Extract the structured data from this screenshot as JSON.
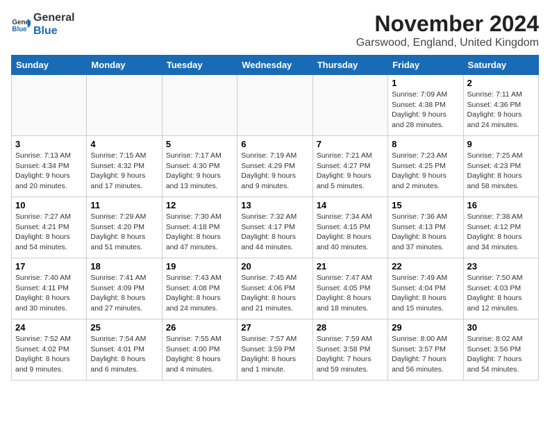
{
  "logo": {
    "general": "General",
    "blue": "Blue"
  },
  "title": "November 2024",
  "location": "Garswood, England, United Kingdom",
  "weekdays": [
    "Sunday",
    "Monday",
    "Tuesday",
    "Wednesday",
    "Thursday",
    "Friday",
    "Saturday"
  ],
  "weeks": [
    [
      {
        "day": "",
        "info": ""
      },
      {
        "day": "",
        "info": ""
      },
      {
        "day": "",
        "info": ""
      },
      {
        "day": "",
        "info": ""
      },
      {
        "day": "",
        "info": ""
      },
      {
        "day": "1",
        "info": "Sunrise: 7:09 AM\nSunset: 4:38 PM\nDaylight: 9 hours\nand 28 minutes."
      },
      {
        "day": "2",
        "info": "Sunrise: 7:11 AM\nSunset: 4:36 PM\nDaylight: 9 hours\nand 24 minutes."
      }
    ],
    [
      {
        "day": "3",
        "info": "Sunrise: 7:13 AM\nSunset: 4:34 PM\nDaylight: 9 hours\nand 20 minutes."
      },
      {
        "day": "4",
        "info": "Sunrise: 7:15 AM\nSunset: 4:32 PM\nDaylight: 9 hours\nand 17 minutes."
      },
      {
        "day": "5",
        "info": "Sunrise: 7:17 AM\nSunset: 4:30 PM\nDaylight: 9 hours\nand 13 minutes."
      },
      {
        "day": "6",
        "info": "Sunrise: 7:19 AM\nSunset: 4:29 PM\nDaylight: 9 hours\nand 9 minutes."
      },
      {
        "day": "7",
        "info": "Sunrise: 7:21 AM\nSunset: 4:27 PM\nDaylight: 9 hours\nand 5 minutes."
      },
      {
        "day": "8",
        "info": "Sunrise: 7:23 AM\nSunset: 4:25 PM\nDaylight: 9 hours\nand 2 minutes."
      },
      {
        "day": "9",
        "info": "Sunrise: 7:25 AM\nSunset: 4:23 PM\nDaylight: 8 hours\nand 58 minutes."
      }
    ],
    [
      {
        "day": "10",
        "info": "Sunrise: 7:27 AM\nSunset: 4:21 PM\nDaylight: 8 hours\nand 54 minutes."
      },
      {
        "day": "11",
        "info": "Sunrise: 7:29 AM\nSunset: 4:20 PM\nDaylight: 8 hours\nand 51 minutes."
      },
      {
        "day": "12",
        "info": "Sunrise: 7:30 AM\nSunset: 4:18 PM\nDaylight: 8 hours\nand 47 minutes."
      },
      {
        "day": "13",
        "info": "Sunrise: 7:32 AM\nSunset: 4:17 PM\nDaylight: 8 hours\nand 44 minutes."
      },
      {
        "day": "14",
        "info": "Sunrise: 7:34 AM\nSunset: 4:15 PM\nDaylight: 8 hours\nand 40 minutes."
      },
      {
        "day": "15",
        "info": "Sunrise: 7:36 AM\nSunset: 4:13 PM\nDaylight: 8 hours\nand 37 minutes."
      },
      {
        "day": "16",
        "info": "Sunrise: 7:38 AM\nSunset: 4:12 PM\nDaylight: 8 hours\nand 34 minutes."
      }
    ],
    [
      {
        "day": "17",
        "info": "Sunrise: 7:40 AM\nSunset: 4:11 PM\nDaylight: 8 hours\nand 30 minutes."
      },
      {
        "day": "18",
        "info": "Sunrise: 7:41 AM\nSunset: 4:09 PM\nDaylight: 8 hours\nand 27 minutes."
      },
      {
        "day": "19",
        "info": "Sunrise: 7:43 AM\nSunset: 4:08 PM\nDaylight: 8 hours\nand 24 minutes."
      },
      {
        "day": "20",
        "info": "Sunrise: 7:45 AM\nSunset: 4:06 PM\nDaylight: 8 hours\nand 21 minutes."
      },
      {
        "day": "21",
        "info": "Sunrise: 7:47 AM\nSunset: 4:05 PM\nDaylight: 8 hours\nand 18 minutes."
      },
      {
        "day": "22",
        "info": "Sunrise: 7:49 AM\nSunset: 4:04 PM\nDaylight: 8 hours\nand 15 minutes."
      },
      {
        "day": "23",
        "info": "Sunrise: 7:50 AM\nSunset: 4:03 PM\nDaylight: 8 hours\nand 12 minutes."
      }
    ],
    [
      {
        "day": "24",
        "info": "Sunrise: 7:52 AM\nSunset: 4:02 PM\nDaylight: 8 hours\nand 9 minutes."
      },
      {
        "day": "25",
        "info": "Sunrise: 7:54 AM\nSunset: 4:01 PM\nDaylight: 8 hours\nand 6 minutes."
      },
      {
        "day": "26",
        "info": "Sunrise: 7:55 AM\nSunset: 4:00 PM\nDaylight: 8 hours\nand 4 minutes."
      },
      {
        "day": "27",
        "info": "Sunrise: 7:57 AM\nSunset: 3:59 PM\nDaylight: 8 hours\nand 1 minute."
      },
      {
        "day": "28",
        "info": "Sunrise: 7:59 AM\nSunset: 3:58 PM\nDaylight: 7 hours\nand 59 minutes."
      },
      {
        "day": "29",
        "info": "Sunrise: 8:00 AM\nSunset: 3:57 PM\nDaylight: 7 hours\nand 56 minutes."
      },
      {
        "day": "30",
        "info": "Sunrise: 8:02 AM\nSunset: 3:56 PM\nDaylight: 7 hours\nand 54 minutes."
      }
    ]
  ]
}
